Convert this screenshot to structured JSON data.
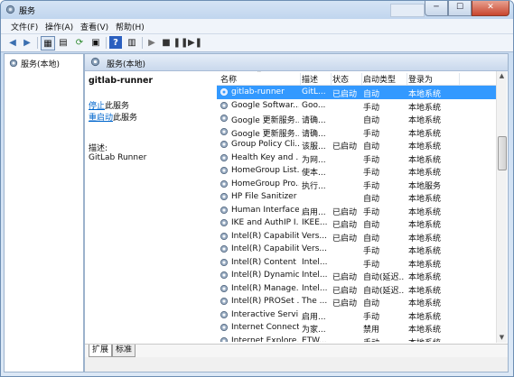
{
  "window": {
    "title": "服务",
    "min": "─",
    "max": "☐",
    "close": "✕"
  },
  "menu": [
    "文件(F)",
    "操作(A)",
    "查看(V)",
    "帮助(H)"
  ],
  "left_tree": {
    "root_label": "服务(本地)"
  },
  "right_header": "服务(本地)",
  "details": {
    "service_name": "gitlab-runner",
    "stop_link": "停止",
    "stop_suffix": "此服务",
    "restart_link": "重启动",
    "restart_suffix": "此服务",
    "desc_label": "描述:",
    "desc_text": "GitLab Runner"
  },
  "columns": {
    "name": "名称",
    "desc": "描述",
    "state": "状态",
    "start": "启动类型",
    "login": "登录为"
  },
  "rows": [
    {
      "name": "gitlab-runner",
      "desc": "GitL...",
      "state": "已启动",
      "start": "自动",
      "login": "本地系统",
      "selected": true
    },
    {
      "name": "Google Softwar...",
      "desc": "Goo...",
      "state": "",
      "start": "手动",
      "login": "本地系统"
    },
    {
      "name": "Google 更新服务...",
      "desc": "请确...",
      "state": "",
      "start": "自动",
      "login": "本地系统"
    },
    {
      "name": "Google 更新服务...",
      "desc": "请确...",
      "state": "",
      "start": "手动",
      "login": "本地系统"
    },
    {
      "name": "Group Policy Cli...",
      "desc": "该服...",
      "state": "已启动",
      "start": "自动",
      "login": "本地系统"
    },
    {
      "name": "Health Key and ...",
      "desc": "为网...",
      "state": "",
      "start": "手动",
      "login": "本地系统"
    },
    {
      "name": "HomeGroup List...",
      "desc": "使本...",
      "state": "",
      "start": "手动",
      "login": "本地系统"
    },
    {
      "name": "HomeGroup Pro...",
      "desc": "执行...",
      "state": "",
      "start": "手动",
      "login": "本地服务"
    },
    {
      "name": "HP File Sanitizer",
      "desc": "",
      "state": "",
      "start": "自动",
      "login": "本地系统"
    },
    {
      "name": "Human Interface...",
      "desc": "启用...",
      "state": "已启动",
      "start": "手动",
      "login": "本地系统"
    },
    {
      "name": "IKE and AuthIP I...",
      "desc": "IKEE...",
      "state": "已启动",
      "start": "自动",
      "login": "本地系统"
    },
    {
      "name": "Intel(R) Capabilit...",
      "desc": "Vers...",
      "state": "已启动",
      "start": "自动",
      "login": "本地系统"
    },
    {
      "name": "Intel(R) Capabilit...",
      "desc": "Vers...",
      "state": "",
      "start": "手动",
      "login": "本地系统"
    },
    {
      "name": "Intel(R) Content ...",
      "desc": "Intel...",
      "state": "",
      "start": "手动",
      "login": "本地系统"
    },
    {
      "name": "Intel(R) Dynamic...",
      "desc": "Intel...",
      "state": "已启动",
      "start": "自动(延迟...",
      "login": "本地系统"
    },
    {
      "name": "Intel(R) Manage...",
      "desc": "Intel...",
      "state": "已启动",
      "start": "自动(延迟...",
      "login": "本地系统"
    },
    {
      "name": "Intel(R) PROSet ...",
      "desc": "The ...",
      "state": "已启动",
      "start": "自动",
      "login": "本地系统"
    },
    {
      "name": "Interactive Servi...",
      "desc": "启用...",
      "state": "",
      "start": "手动",
      "login": "本地系统"
    },
    {
      "name": "Internet Connect...",
      "desc": "为家...",
      "state": "",
      "start": "禁用",
      "login": "本地系统"
    },
    {
      "name": "Internet Explore...",
      "desc": "ETW...",
      "state": "",
      "start": "手动",
      "login": "本地系统"
    }
  ],
  "tabs": [
    "扩展",
    "标准"
  ]
}
